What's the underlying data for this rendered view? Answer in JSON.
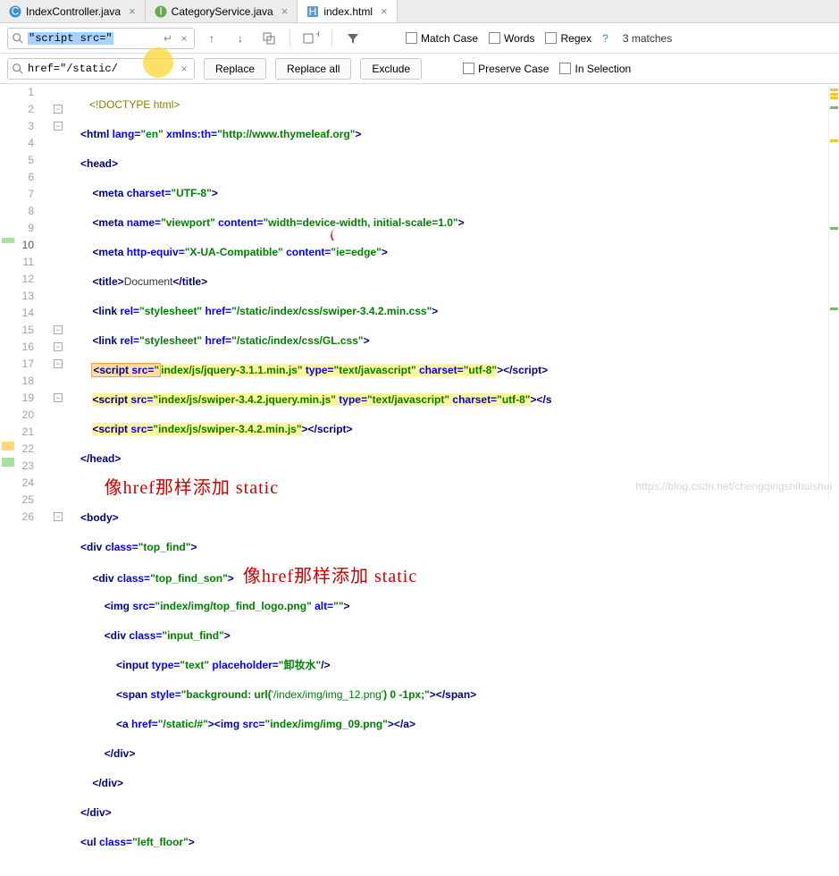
{
  "tabs": [
    {
      "label": "IndexController.java",
      "icon": "C",
      "icon_bg": "#3b8fd4"
    },
    {
      "label": "CategoryService.java",
      "icon": "I",
      "icon_bg": "#6aa84f"
    },
    {
      "label": "index.html",
      "icon": "H",
      "icon_bg": "#4a90d9",
      "active": true
    }
  ],
  "find": {
    "search_text": "\"script src=\"",
    "replace_text": "href=\"/static/",
    "replace_btn": "Replace",
    "replace_all_btn": "Replace all",
    "exclude_btn": "Exclude",
    "match_case": "Match Case",
    "words": "Words",
    "regex": "Regex",
    "preserve_case": "Preserve Case",
    "in_selection": "In Selection",
    "help": "?",
    "matches": "3 matches"
  },
  "code": {
    "l1": "<!DOCTYPE html>",
    "l2_a": "<html ",
    "l2_b": "lang=",
    "l2_c": "\"en\"",
    "l2_d": " xmlns:th=",
    "l2_e": "\"http://www.thymeleaf.org\"",
    "l2_f": ">",
    "l3": "<head>",
    "l4_a": "<meta ",
    "l4_b": "charset=",
    "l4_c": "\"UTF-8\"",
    "l4_d": ">",
    "l5_a": "<meta ",
    "l5_b": "name=",
    "l5_c": "\"viewport\"",
    "l5_d": " content=",
    "l5_e": "\"width=device-width, initial-scale=1.0\"",
    "l5_f": ">",
    "l6_a": "<meta ",
    "l6_b": "http-equiv=",
    "l6_c": "\"X-UA-Compatible\"",
    "l6_d": " content=",
    "l6_e": "\"ie=edge\"",
    "l6_f": ">",
    "l7_a": "<title>",
    "l7_b": "Document",
    "l7_c": "</title>",
    "l8_a": "<link ",
    "l8_b": "rel=",
    "l8_c": "\"stylesheet\"",
    "l8_d": " href=",
    "l8_e": "\"/static/index/css/swiper-3.4.2.min.css\"",
    "l8_f": ">",
    "l9_a": "<link ",
    "l9_b": "rel=",
    "l9_c": "\"stylesheet\"",
    "l9_d": " href=",
    "l9_e": "\"/static/index/css/GL.css\"",
    "l9_f": ">",
    "l10_a": "<script ",
    "l10_b": "src=",
    "l10_c": "\"index/js/jquery-3.1.1.min.js\"",
    "l10_d": " type=",
    "l10_e": "\"text/javascript\"",
    "l10_f": " charset=",
    "l10_g": "\"utf-8\"",
    "l10_h": "></script>",
    "l11_a": "<script ",
    "l11_b": "src=",
    "l11_c": "\"index/js/swiper-3.4.2.jquery.min.js\"",
    "l11_d": " type=",
    "l11_e": "\"text/javascript\"",
    "l11_f": " charset=",
    "l11_g": "\"utf-8\"",
    "l11_h": "></s",
    "l12_a": "<script ",
    "l12_b": "src=",
    "l12_c": "\"index/js/swiper-3.4.2.min.js\"",
    "l12_d": "></script>",
    "l13": "</head>",
    "l15": "<body>",
    "l16_a": "<div ",
    "l16_b": "class=",
    "l16_c": "\"top_find\"",
    "l16_d": ">",
    "l17_a": "<div ",
    "l17_b": "class=",
    "l17_c": "\"top_find_son\"",
    "l17_d": ">",
    "l18_a": "<img ",
    "l18_b": "src=",
    "l18_c": "\"index/img/top_find_logo.png\"",
    "l18_d": " alt=",
    "l18_e": "\"\"",
    "l18_f": ">",
    "l19_a": "<div ",
    "l19_b": "class=",
    "l19_c": "\"input_find\"",
    "l19_d": ">",
    "l20_a": "<input ",
    "l20_b": "type=",
    "l20_c": "\"text\"",
    "l20_d": " placeholder=",
    "l20_e": "\"卸妆水\"",
    "l20_f": "/>",
    "l21_a": "<span ",
    "l21_b": "style=",
    "l21_c": "\"background: url(",
    "l21_d": "'/index/img/img_12.png'",
    "l21_e": ") 0 -1px;\"",
    "l21_f": "></span>",
    "l22_a": "<a ",
    "l22_b": "href=",
    "l22_c": "\"/static/#\"",
    "l22_d": "><img ",
    "l22_e": "src=",
    "l22_f": "\"index/img/img_09.png\"",
    "l22_g": "></a>",
    "l23": "</div>",
    "l24": "</div>",
    "l25": "</div>",
    "l26_a": "<ul ",
    "l26_b": "class=",
    "l26_c": "\"left_floor\"",
    "l26_d": ">"
  },
  "annot1": "像href那样添加 static",
  "annot2": "像href那样添加 static",
  "watermark": "https://blog.csdn.net/chengqingshihuishui"
}
